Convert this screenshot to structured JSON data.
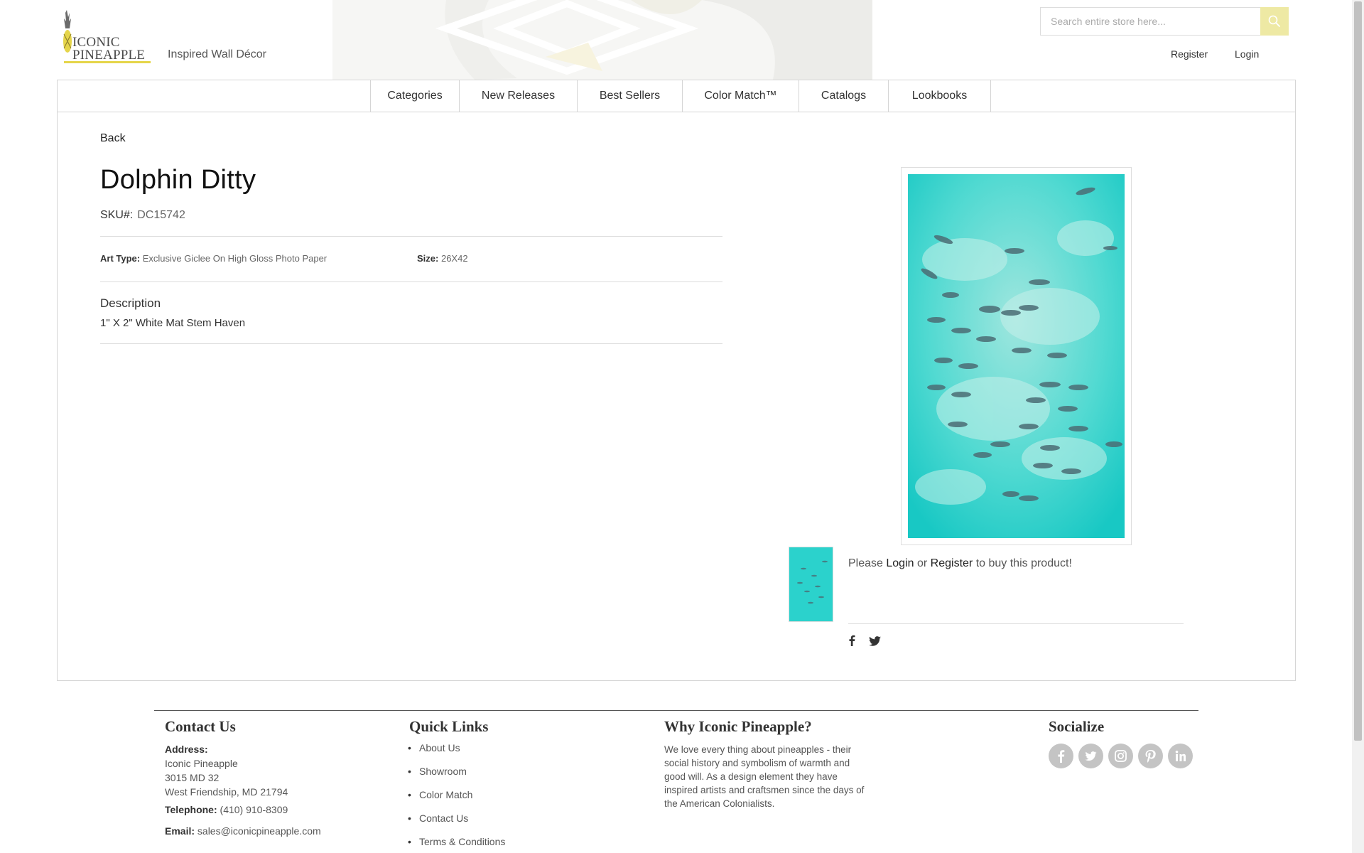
{
  "header": {
    "logo_line1": "ICONIC",
    "logo_line2": "PINEAPPLE",
    "tagline": "Inspired Wall Décor",
    "search_placeholder": "Search entire store here...",
    "register": "Register",
    "login": "Login"
  },
  "nav": [
    "Categories",
    "New Releases",
    "Best Sellers",
    "Color Match™",
    "Catalogs",
    "Lookbooks"
  ],
  "product": {
    "back": "Back",
    "title": "Dolphin Ditty",
    "sku_label": "SKU#:",
    "sku_value": "DC15742",
    "art_type_label": "Art Type:",
    "art_type_value": "Exclusive Giclee On High Gloss Photo Paper",
    "size_label": "Size:",
    "size_value": "26X42",
    "description_heading": "Description",
    "description_text": "1\" X 2\" White Mat Stem Haven",
    "buy_prefix": "Please",
    "buy_login": "Login",
    "buy_or": "or",
    "buy_register": "Register",
    "buy_suffix": "to buy this product!"
  },
  "footer": {
    "contact": {
      "heading": "Contact Us",
      "address_label": "Address:",
      "address_lines": [
        "Iconic Pineapple",
        "3015 MD 32",
        "West Friendship, MD 21794"
      ],
      "telephone_label": "Telephone:",
      "telephone": "(410) 910-8309",
      "email_label": "Email:",
      "email": "sales@iconicpineapple.com"
    },
    "quick_links": {
      "heading": "Quick Links",
      "items": [
        "About Us",
        "Showroom",
        "Color Match",
        "Contact Us",
        "Terms & Conditions"
      ]
    },
    "why": {
      "heading": "Why Iconic Pineapple?",
      "lines": [
        "We love every thing about pineapples - their",
        "social history and symbolism of warmth and",
        "good will. As a design element they have",
        "inspired artists and craftsmen since the days of",
        "the American Colonialists."
      ]
    },
    "socialize": {
      "heading": "Socialize",
      "icons": [
        "facebook-icon",
        "twitter-icon",
        "instagram-icon",
        "pinterest-icon",
        "linkedin-icon"
      ]
    }
  },
  "colors": {
    "accent_yellow": "#e5d54a",
    "search_button": "#eee9a4",
    "sea": "#2bd2cc",
    "social_grey": "#c4c4c4"
  }
}
